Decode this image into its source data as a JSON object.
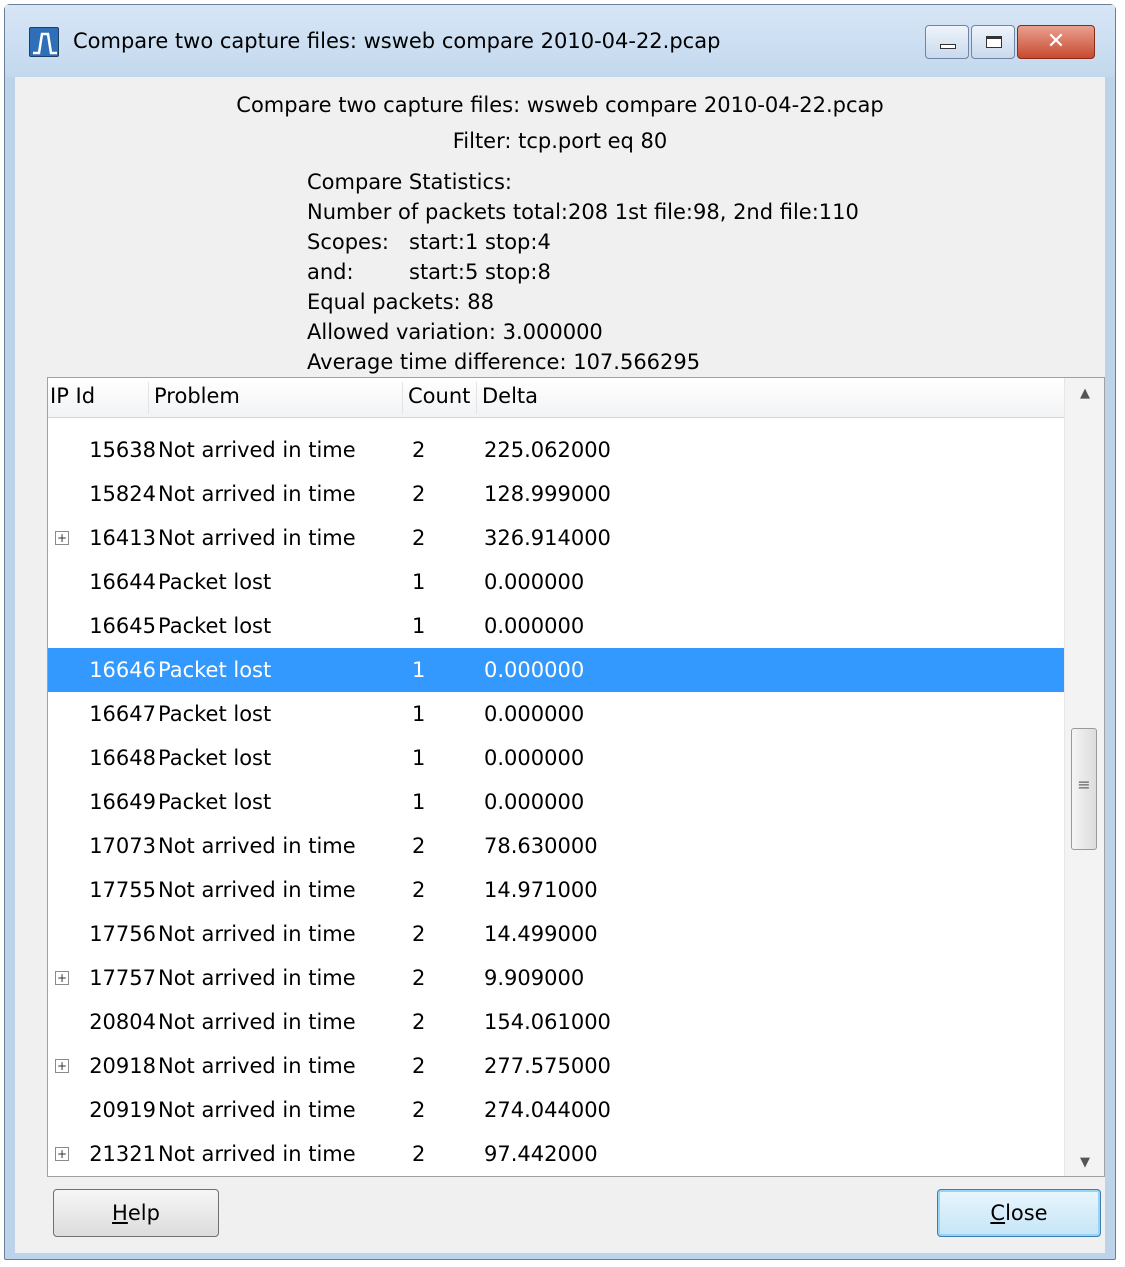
{
  "window": {
    "title": "Compare two capture files: wsweb compare 2010-04-22.pcap"
  },
  "header": {
    "title": "Compare two capture files: wsweb compare 2010-04-22.pcap",
    "filter": "Filter: tcp.port eq 80"
  },
  "stats": {
    "heading": "Compare Statistics:",
    "packets": "Number of packets total:208 1st file:98, 2nd file:110",
    "scopes_label": "Scopes:",
    "scopes_value": "start:1 stop:4",
    "and_label": "and:",
    "and_value": "start:5 stop:8",
    "equal": "Equal packets: 88",
    "variation": "Allowed variation: 3.000000",
    "avg_diff": "Average time difference: 107.566295"
  },
  "table": {
    "columns": [
      "IP Id",
      "Problem",
      "Count",
      "Delta"
    ],
    "rows": [
      {
        "ipid": "15638",
        "problem": "Not arrived in time",
        "count": "2",
        "delta": "225.062000",
        "expandable": false,
        "selected": false
      },
      {
        "ipid": "15824",
        "problem": "Not arrived in time",
        "count": "2",
        "delta": "128.999000",
        "expandable": false,
        "selected": false
      },
      {
        "ipid": "16413",
        "problem": "Not arrived in time",
        "count": "2",
        "delta": "326.914000",
        "expandable": true,
        "selected": false
      },
      {
        "ipid": "16644",
        "problem": "Packet lost",
        "count": "1",
        "delta": "0.000000",
        "expandable": false,
        "selected": false
      },
      {
        "ipid": "16645",
        "problem": "Packet lost",
        "count": "1",
        "delta": "0.000000",
        "expandable": false,
        "selected": false
      },
      {
        "ipid": "16646",
        "problem": "Packet lost",
        "count": "1",
        "delta": "0.000000",
        "expandable": false,
        "selected": true
      },
      {
        "ipid": "16647",
        "problem": "Packet lost",
        "count": "1",
        "delta": "0.000000",
        "expandable": false,
        "selected": false
      },
      {
        "ipid": "16648",
        "problem": "Packet lost",
        "count": "1",
        "delta": "0.000000",
        "expandable": false,
        "selected": false
      },
      {
        "ipid": "16649",
        "problem": "Packet lost",
        "count": "1",
        "delta": "0.000000",
        "expandable": false,
        "selected": false
      },
      {
        "ipid": "17073",
        "problem": "Not arrived in time",
        "count": "2",
        "delta": "78.630000",
        "expandable": false,
        "selected": false
      },
      {
        "ipid": "17755",
        "problem": "Not arrived in time",
        "count": "2",
        "delta": "14.971000",
        "expandable": false,
        "selected": false
      },
      {
        "ipid": "17756",
        "problem": "Not arrived in time",
        "count": "2",
        "delta": "14.499000",
        "expandable": false,
        "selected": false
      },
      {
        "ipid": "17757",
        "problem": "Not arrived in time",
        "count": "2",
        "delta": "9.909000",
        "expandable": true,
        "selected": false
      },
      {
        "ipid": "20804",
        "problem": "Not arrived in time",
        "count": "2",
        "delta": "154.061000",
        "expandable": false,
        "selected": false
      },
      {
        "ipid": "20918",
        "problem": "Not arrived in time",
        "count": "2",
        "delta": "277.575000",
        "expandable": true,
        "selected": false
      },
      {
        "ipid": "20919",
        "problem": "Not arrived in time",
        "count": "2",
        "delta": "274.044000",
        "expandable": false,
        "selected": false
      },
      {
        "ipid": "21321",
        "problem": "Not arrived in time",
        "count": "2",
        "delta": "97.442000",
        "expandable": true,
        "selected": false
      }
    ]
  },
  "buttons": {
    "help_mnemonic": "H",
    "help_rest": "elp",
    "close_mnemonic": "C",
    "close_rest": "lose"
  },
  "icons": {
    "app": "wireshark-graph-icon",
    "expand": "plus-box-icon"
  },
  "colors": {
    "selection": "#3399ff",
    "titlebar": "#c3d8ee"
  }
}
